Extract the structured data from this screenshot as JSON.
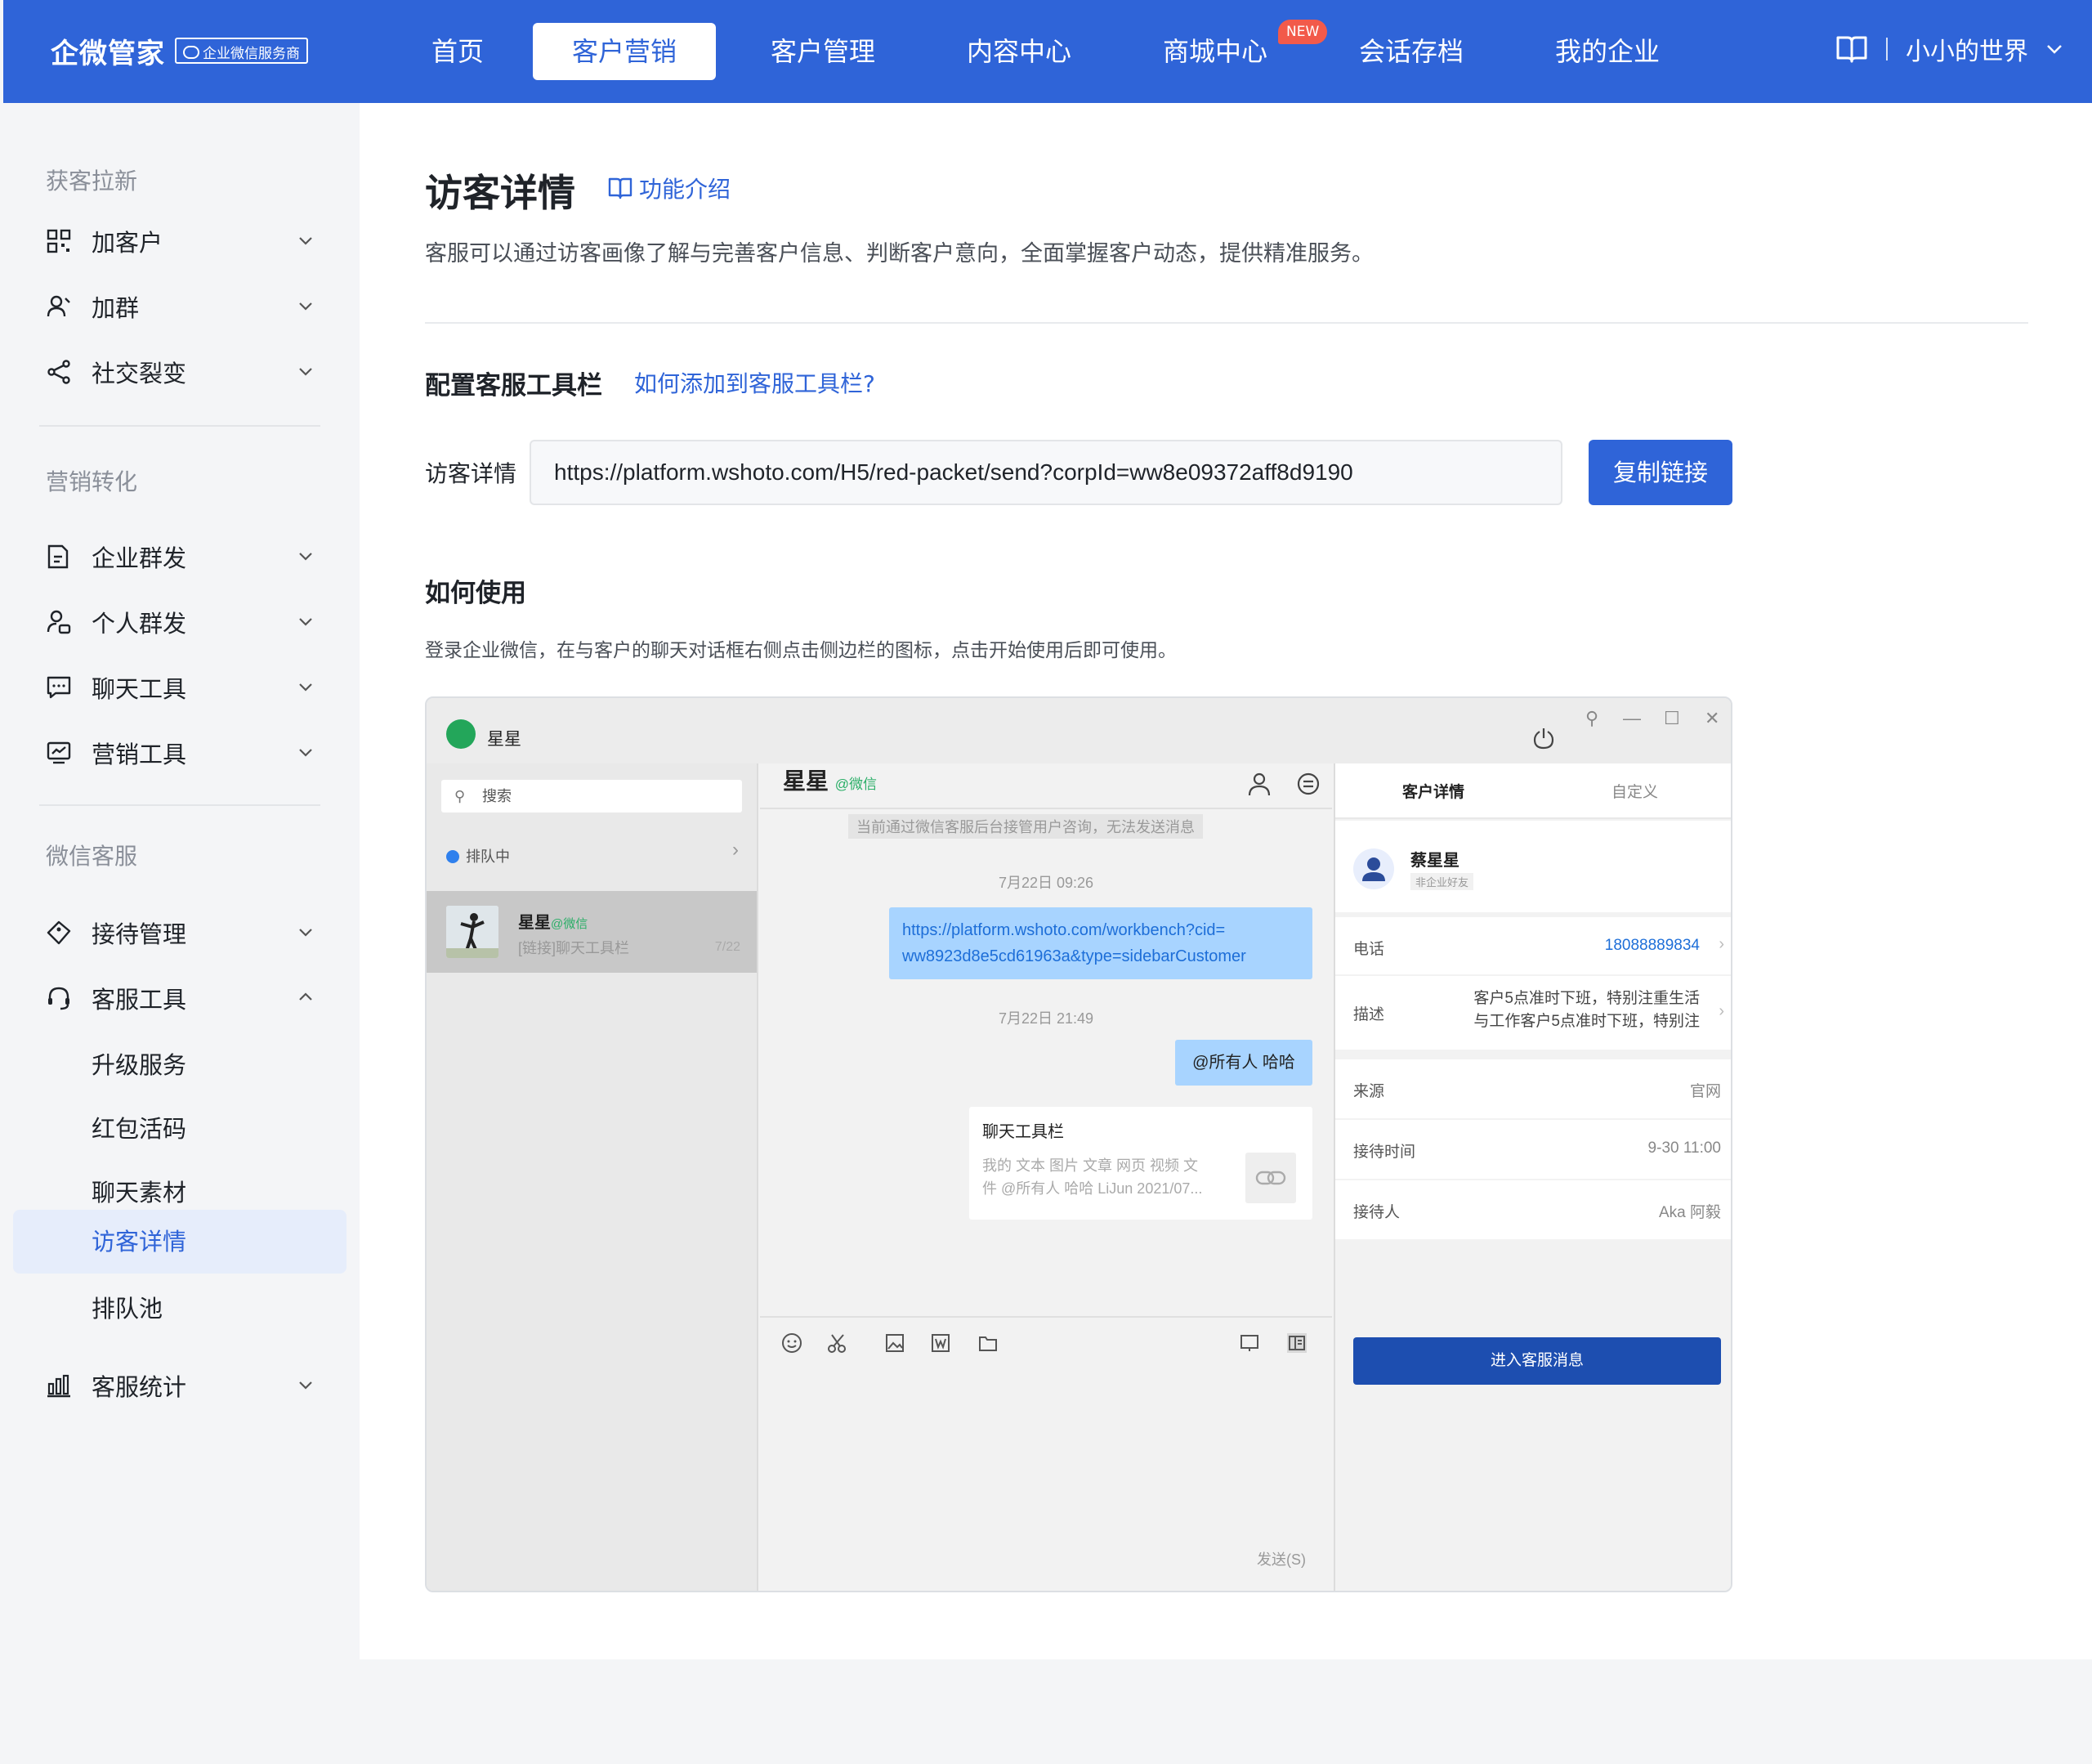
{
  "brand": {
    "name": "企微管家",
    "badge": "企业微信服务商"
  },
  "nav": {
    "items": [
      "首页",
      "客户营销",
      "客户管理",
      "内容中心",
      "商城中心",
      "会话存档",
      "我的企业"
    ],
    "active": "客户营销",
    "new_badge": "NEW"
  },
  "account": {
    "name": "小小的世界"
  },
  "sidebar": {
    "groups": [
      "获客拉新",
      "营销转化",
      "微信客服"
    ],
    "g1": [
      "加客户",
      "加群",
      "社交裂变"
    ],
    "g2": [
      "企业群发",
      "个人群发",
      "聊天工具",
      "营销工具"
    ],
    "g3": [
      "接待管理",
      "客服工具"
    ],
    "sub": [
      "升级服务",
      "红包活码",
      "聊天素材",
      "访客详情",
      "排队池"
    ],
    "stats": "客服统计"
  },
  "page": {
    "title": "访客详情",
    "feature_link": "功能介绍",
    "description": "客服可以通过访客画像了解与完善客户信息、判断客户意向，全面掌握客户动态，提供精准服务。",
    "section_config": "配置客服工具栏",
    "section_config_link": "如何添加到客服工具栏?",
    "url_label": "访客详情",
    "url_value": "https://platform.wshoto.com/H5/red-packet/send?corpId=ww8e09372aff8d9190",
    "copy_button": "复制链接",
    "section_usage": "如何使用",
    "usage_text": "登录企业微信，在与客户的聊天对话框右侧点击侧边栏的图标，点击开始使用后即可使用。"
  },
  "shot": {
    "window_name": "星星",
    "search_placeholder": "搜索",
    "queue": "排队中",
    "conv_name": "星星",
    "conv_tag": "@微信",
    "conv_last": "[链接]聊天工具栏",
    "conv_date": "7/22",
    "chat_title": "星星",
    "chat_tag": "@微信",
    "chat_note": "当前通过微信客服后台接管用户咨询，无法发送消息",
    "time1": "7月22日 09:26",
    "link_line1": "https://platform.wshoto.com/workbench?cid=",
    "link_line2": "ww8923d8e5cd61963a&type=sidebarCustomer",
    "time2": "7月22日 21:49",
    "at_msg": "@所有人 哈哈",
    "card_title": "聊天工具栏",
    "card_line1": "我的 文本 图片 文章 网页 视频 文",
    "card_line2": "件 @所有人 哈哈 LiJun 2021/07...",
    "send": "发送(S)",
    "tab_detail": "客户详情",
    "tab_custom": "自定义",
    "customer_name": "蔡星星",
    "customer_tag": "非企业好友",
    "phone_label": "电话",
    "phone_value": "18088889834",
    "desc_label": "描述",
    "desc_line1": "客户5点准时下班，特别注重生活",
    "desc_line2": "与工作客户5点准时下班，特别注",
    "source_label": "来源",
    "source_value": "官网",
    "time_label": "接待时间",
    "time_value": "9-30 11:00",
    "agent_label": "接待人",
    "agent_value": "Aka 阿毅",
    "enter_button": "进入客服消息"
  },
  "colors": {
    "primary": "#2f64d8",
    "active_bg": "#e6edfb",
    "badge": "#f25a4a"
  }
}
